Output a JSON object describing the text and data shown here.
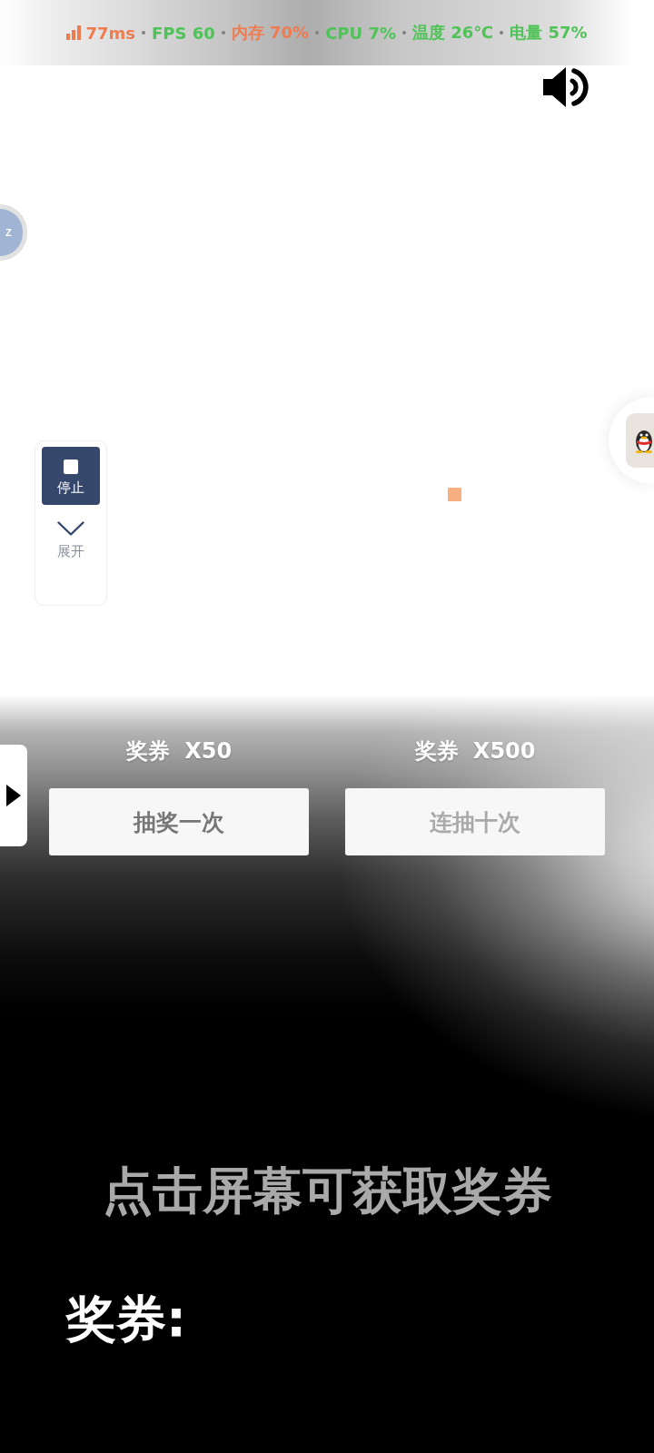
{
  "stats": [
    {
      "kind": "latency",
      "text": "77ms",
      "color": "#ef7b50"
    },
    {
      "kind": "plain",
      "text": "FPS 60",
      "color": "#4fc357"
    },
    {
      "kind": "plain",
      "text": "内存 70%",
      "color": "#ef7b50"
    },
    {
      "kind": "plain",
      "text": "CPU 7%",
      "color": "#4fc357"
    },
    {
      "kind": "plain",
      "text": "温度 26℃",
      "color": "#4fc357"
    },
    {
      "kind": "plain",
      "text": "电量 57%",
      "color": "#4fc357"
    }
  ],
  "sound": {
    "on": true
  },
  "float_ball": {
    "label": "Z"
  },
  "control_panel": {
    "stop_button": {
      "label": "停止"
    },
    "expand_button": {
      "label": "展开",
      "expanded": false
    }
  },
  "draws": [
    {
      "cost": "奖券 X50",
      "label": "抽奖一次",
      "disabled": false
    },
    {
      "cost": "奖券 X500",
      "label": "连抽十次",
      "disabled": true
    }
  ],
  "hint": "点击屏幕可获取奖券",
  "tickets": {
    "label": "奖券:"
  }
}
